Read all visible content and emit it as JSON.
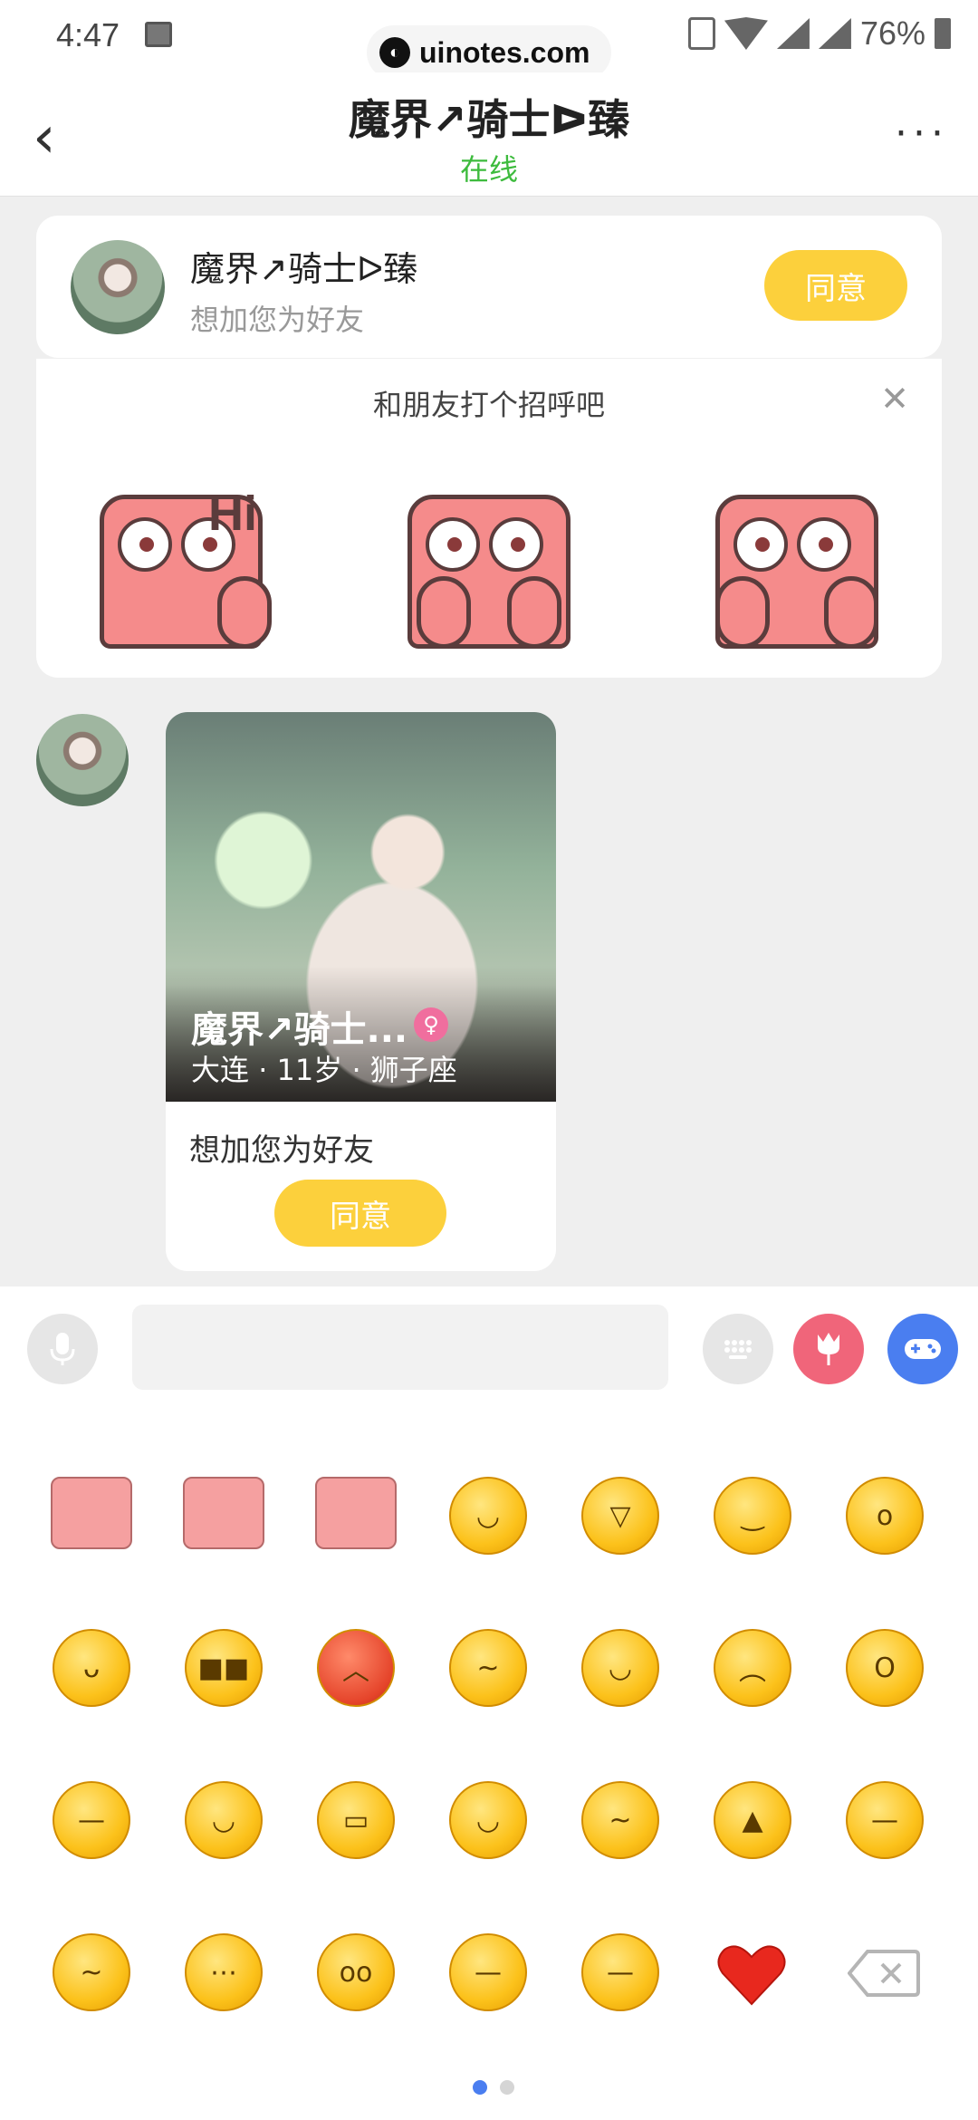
{
  "status_bar": {
    "time": "4:47",
    "battery": "76%",
    "watermark": "uinotes.com"
  },
  "header": {
    "title": "魔界↗骑士ᐅ臻",
    "status": "在线",
    "back_icon": "back-arrow-icon",
    "more_label": "···"
  },
  "request": {
    "name": "魔界↗骑士ᐅ臻",
    "subtitle": "想加您为好友",
    "agree_label": "同意"
  },
  "greeting": {
    "title": "和朋友打个招呼吧",
    "close_label": "✕",
    "sticker_hi_text": "Hi"
  },
  "message_card": {
    "name": "魔界↗骑士...",
    "city": "大连",
    "age": "11岁",
    "zodiac": "狮子座",
    "message": "想加您为好友",
    "agree_label": "同意"
  },
  "input": {
    "placeholder": ""
  },
  "colors": {
    "accent_yellow": "#fcd03c",
    "online_green": "#3dbb3d",
    "gift_pink": "#f0657a",
    "game_blue": "#4a7ef0"
  }
}
